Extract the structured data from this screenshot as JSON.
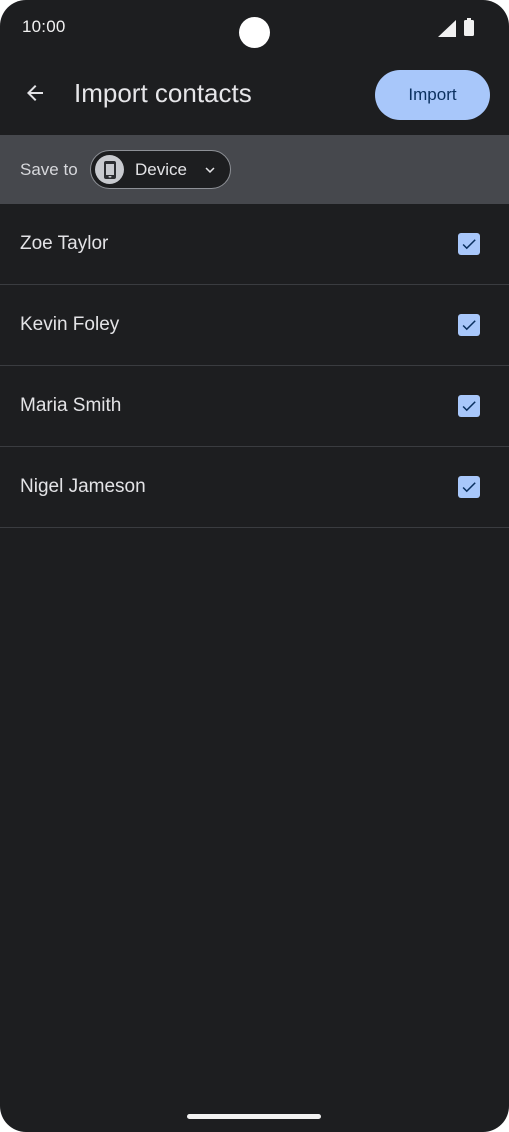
{
  "status_bar": {
    "time": "10:00",
    "icons": [
      "camera-cutout",
      "signal-icon",
      "battery-icon"
    ]
  },
  "app_bar": {
    "back_icon": "arrow-back-icon",
    "title": "Import contacts",
    "import_label": "Import"
  },
  "save_to": {
    "label": "Save to",
    "account": "Device",
    "account_icon": "phone-device-icon",
    "dropdown_icon": "chevron-down-icon"
  },
  "contacts": [
    {
      "name": "Zoe Taylor",
      "checked": true
    },
    {
      "name": "Kevin Foley",
      "checked": true
    },
    {
      "name": "Maria Smith",
      "checked": true
    },
    {
      "name": "Nigel Jameson",
      "checked": true
    }
  ],
  "colors": {
    "background": "#1d1e20",
    "accent": "#a8c7fa",
    "save_bar": "#46484d",
    "on_accent": "#0a305f"
  }
}
